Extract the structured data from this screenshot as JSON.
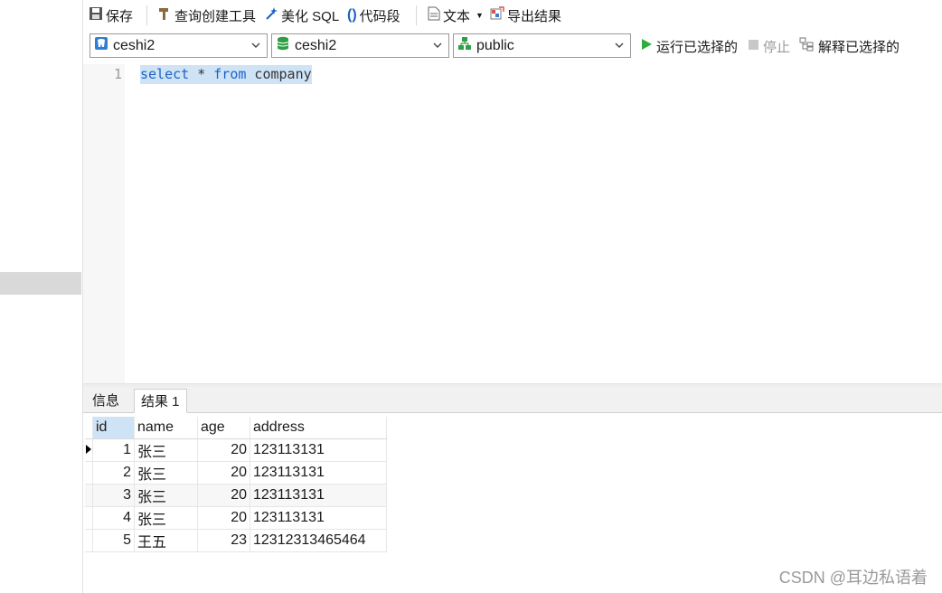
{
  "toolbar": {
    "save": "保存",
    "query_builder": "查询创建工具",
    "beautify_sql": "美化 SQL",
    "code_snippet": "代码段",
    "text": "文本",
    "export_result": "导出结果"
  },
  "selectors": {
    "connection": "ceshi2",
    "database": "ceshi2",
    "schema": "public"
  },
  "actions": {
    "run_selected": "运行已选择的",
    "stop": "停止",
    "explain_selected": "解释已选择的"
  },
  "editor": {
    "line_number": "1",
    "kw_select": "select",
    "star": " * ",
    "kw_from": "from",
    "table": " company"
  },
  "result_tabs": [
    "信息",
    "结果 1"
  ],
  "grid": {
    "columns": [
      "id",
      "name",
      "age",
      "address"
    ],
    "rows": [
      [
        "1",
        "张三",
        "20",
        "123113131"
      ],
      [
        "2",
        "张三",
        "20",
        "123113131"
      ],
      [
        "3",
        "张三",
        "20",
        "123113131"
      ],
      [
        "4",
        "张三",
        "20",
        "123113131"
      ],
      [
        "5",
        "王五",
        "23",
        "12312313465464"
      ]
    ]
  },
  "watermark": "CSDN @耳边私语着",
  "colors": {
    "selection": "#cfe3f7",
    "keyword": "#1a63c6",
    "run_green": "#2eae3a",
    "db_green": "#2ea043"
  }
}
